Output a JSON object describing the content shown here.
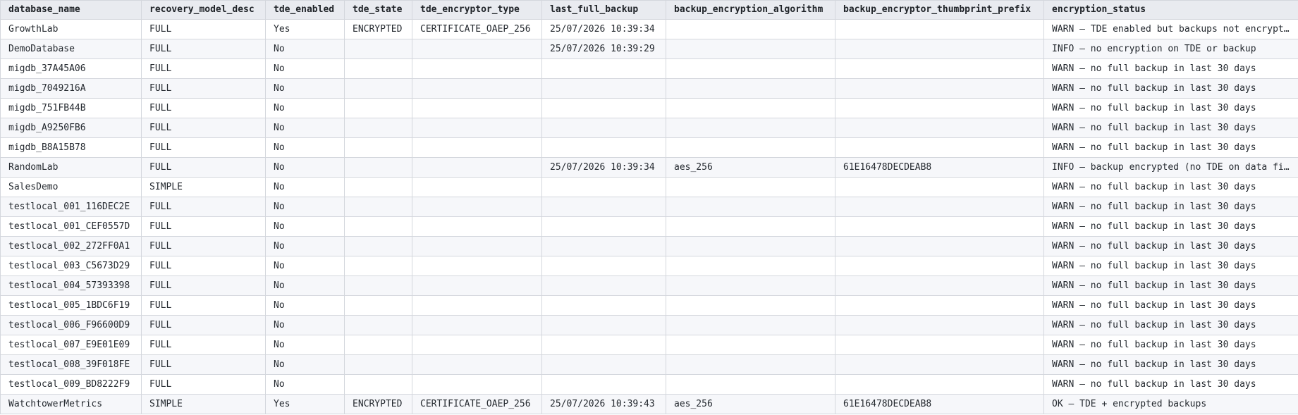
{
  "columns": [
    "database_name",
    "recovery_model_desc",
    "tde_enabled",
    "tde_state",
    "tde_encryptor_type",
    "last_full_backup",
    "backup_encryption_algorithm",
    "backup_encryptor_thumbprint_prefix",
    "encryption_status"
  ],
  "rows": [
    [
      "GrowthLab",
      "FULL",
      "Yes",
      "ENCRYPTED",
      "CERTIFICATE_OAEP_256",
      "25/07/2026 10:39:34",
      "",
      "",
      "WARN — TDE enabled but backups not encrypted"
    ],
    [
      "DemoDatabase",
      "FULL",
      "No",
      "",
      "",
      "25/07/2026 10:39:29",
      "",
      "",
      "INFO — no encryption on TDE or backup"
    ],
    [
      "migdb_37A45A06",
      "FULL",
      "No",
      "",
      "",
      "",
      "",
      "",
      "WARN — no full backup in last 30 days"
    ],
    [
      "migdb_7049216A",
      "FULL",
      "No",
      "",
      "",
      "",
      "",
      "",
      "WARN — no full backup in last 30 days"
    ],
    [
      "migdb_751FB44B",
      "FULL",
      "No",
      "",
      "",
      "",
      "",
      "",
      "WARN — no full backup in last 30 days"
    ],
    [
      "migdb_A9250FB6",
      "FULL",
      "No",
      "",
      "",
      "",
      "",
      "",
      "WARN — no full backup in last 30 days"
    ],
    [
      "migdb_B8A15B78",
      "FULL",
      "No",
      "",
      "",
      "",
      "",
      "",
      "WARN — no full backup in last 30 days"
    ],
    [
      "RandomLab",
      "FULL",
      "No",
      "",
      "",
      "25/07/2026 10:39:34",
      "aes_256",
      "61E16478DECDEAB8",
      "INFO — backup encrypted (no TDE on data files)"
    ],
    [
      "SalesDemo",
      "SIMPLE",
      "No",
      "",
      "",
      "",
      "",
      "",
      "WARN — no full backup in last 30 days"
    ],
    [
      "testlocal_001_116DEC2E",
      "FULL",
      "No",
      "",
      "",
      "",
      "",
      "",
      "WARN — no full backup in last 30 days"
    ],
    [
      "testlocal_001_CEF0557D",
      "FULL",
      "No",
      "",
      "",
      "",
      "",
      "",
      "WARN — no full backup in last 30 days"
    ],
    [
      "testlocal_002_272FF0A1",
      "FULL",
      "No",
      "",
      "",
      "",
      "",
      "",
      "WARN — no full backup in last 30 days"
    ],
    [
      "testlocal_003_C5673D29",
      "FULL",
      "No",
      "",
      "",
      "",
      "",
      "",
      "WARN — no full backup in last 30 days"
    ],
    [
      "testlocal_004_57393398",
      "FULL",
      "No",
      "",
      "",
      "",
      "",
      "",
      "WARN — no full backup in last 30 days"
    ],
    [
      "testlocal_005_1BDC6F19",
      "FULL",
      "No",
      "",
      "",
      "",
      "",
      "",
      "WARN — no full backup in last 30 days"
    ],
    [
      "testlocal_006_F96600D9",
      "FULL",
      "No",
      "",
      "",
      "",
      "",
      "",
      "WARN — no full backup in last 30 days"
    ],
    [
      "testlocal_007_E9E01E09",
      "FULL",
      "No",
      "",
      "",
      "",
      "",
      "",
      "WARN — no full backup in last 30 days"
    ],
    [
      "testlocal_008_39F018FE",
      "FULL",
      "No",
      "",
      "",
      "",
      "",
      "",
      "WARN — no full backup in last 30 days"
    ],
    [
      "testlocal_009_BD8222F9",
      "FULL",
      "No",
      "",
      "",
      "",
      "",
      "",
      "WARN — no full backup in last 30 days"
    ],
    [
      "WatchtowerMetrics",
      "SIMPLE",
      "Yes",
      "ENCRYPTED",
      "CERTIFICATE_OAEP_256",
      "25/07/2026 10:39:43",
      "aes_256",
      "61E16478DECDEAB8",
      "OK — TDE + encrypted backups"
    ]
  ]
}
